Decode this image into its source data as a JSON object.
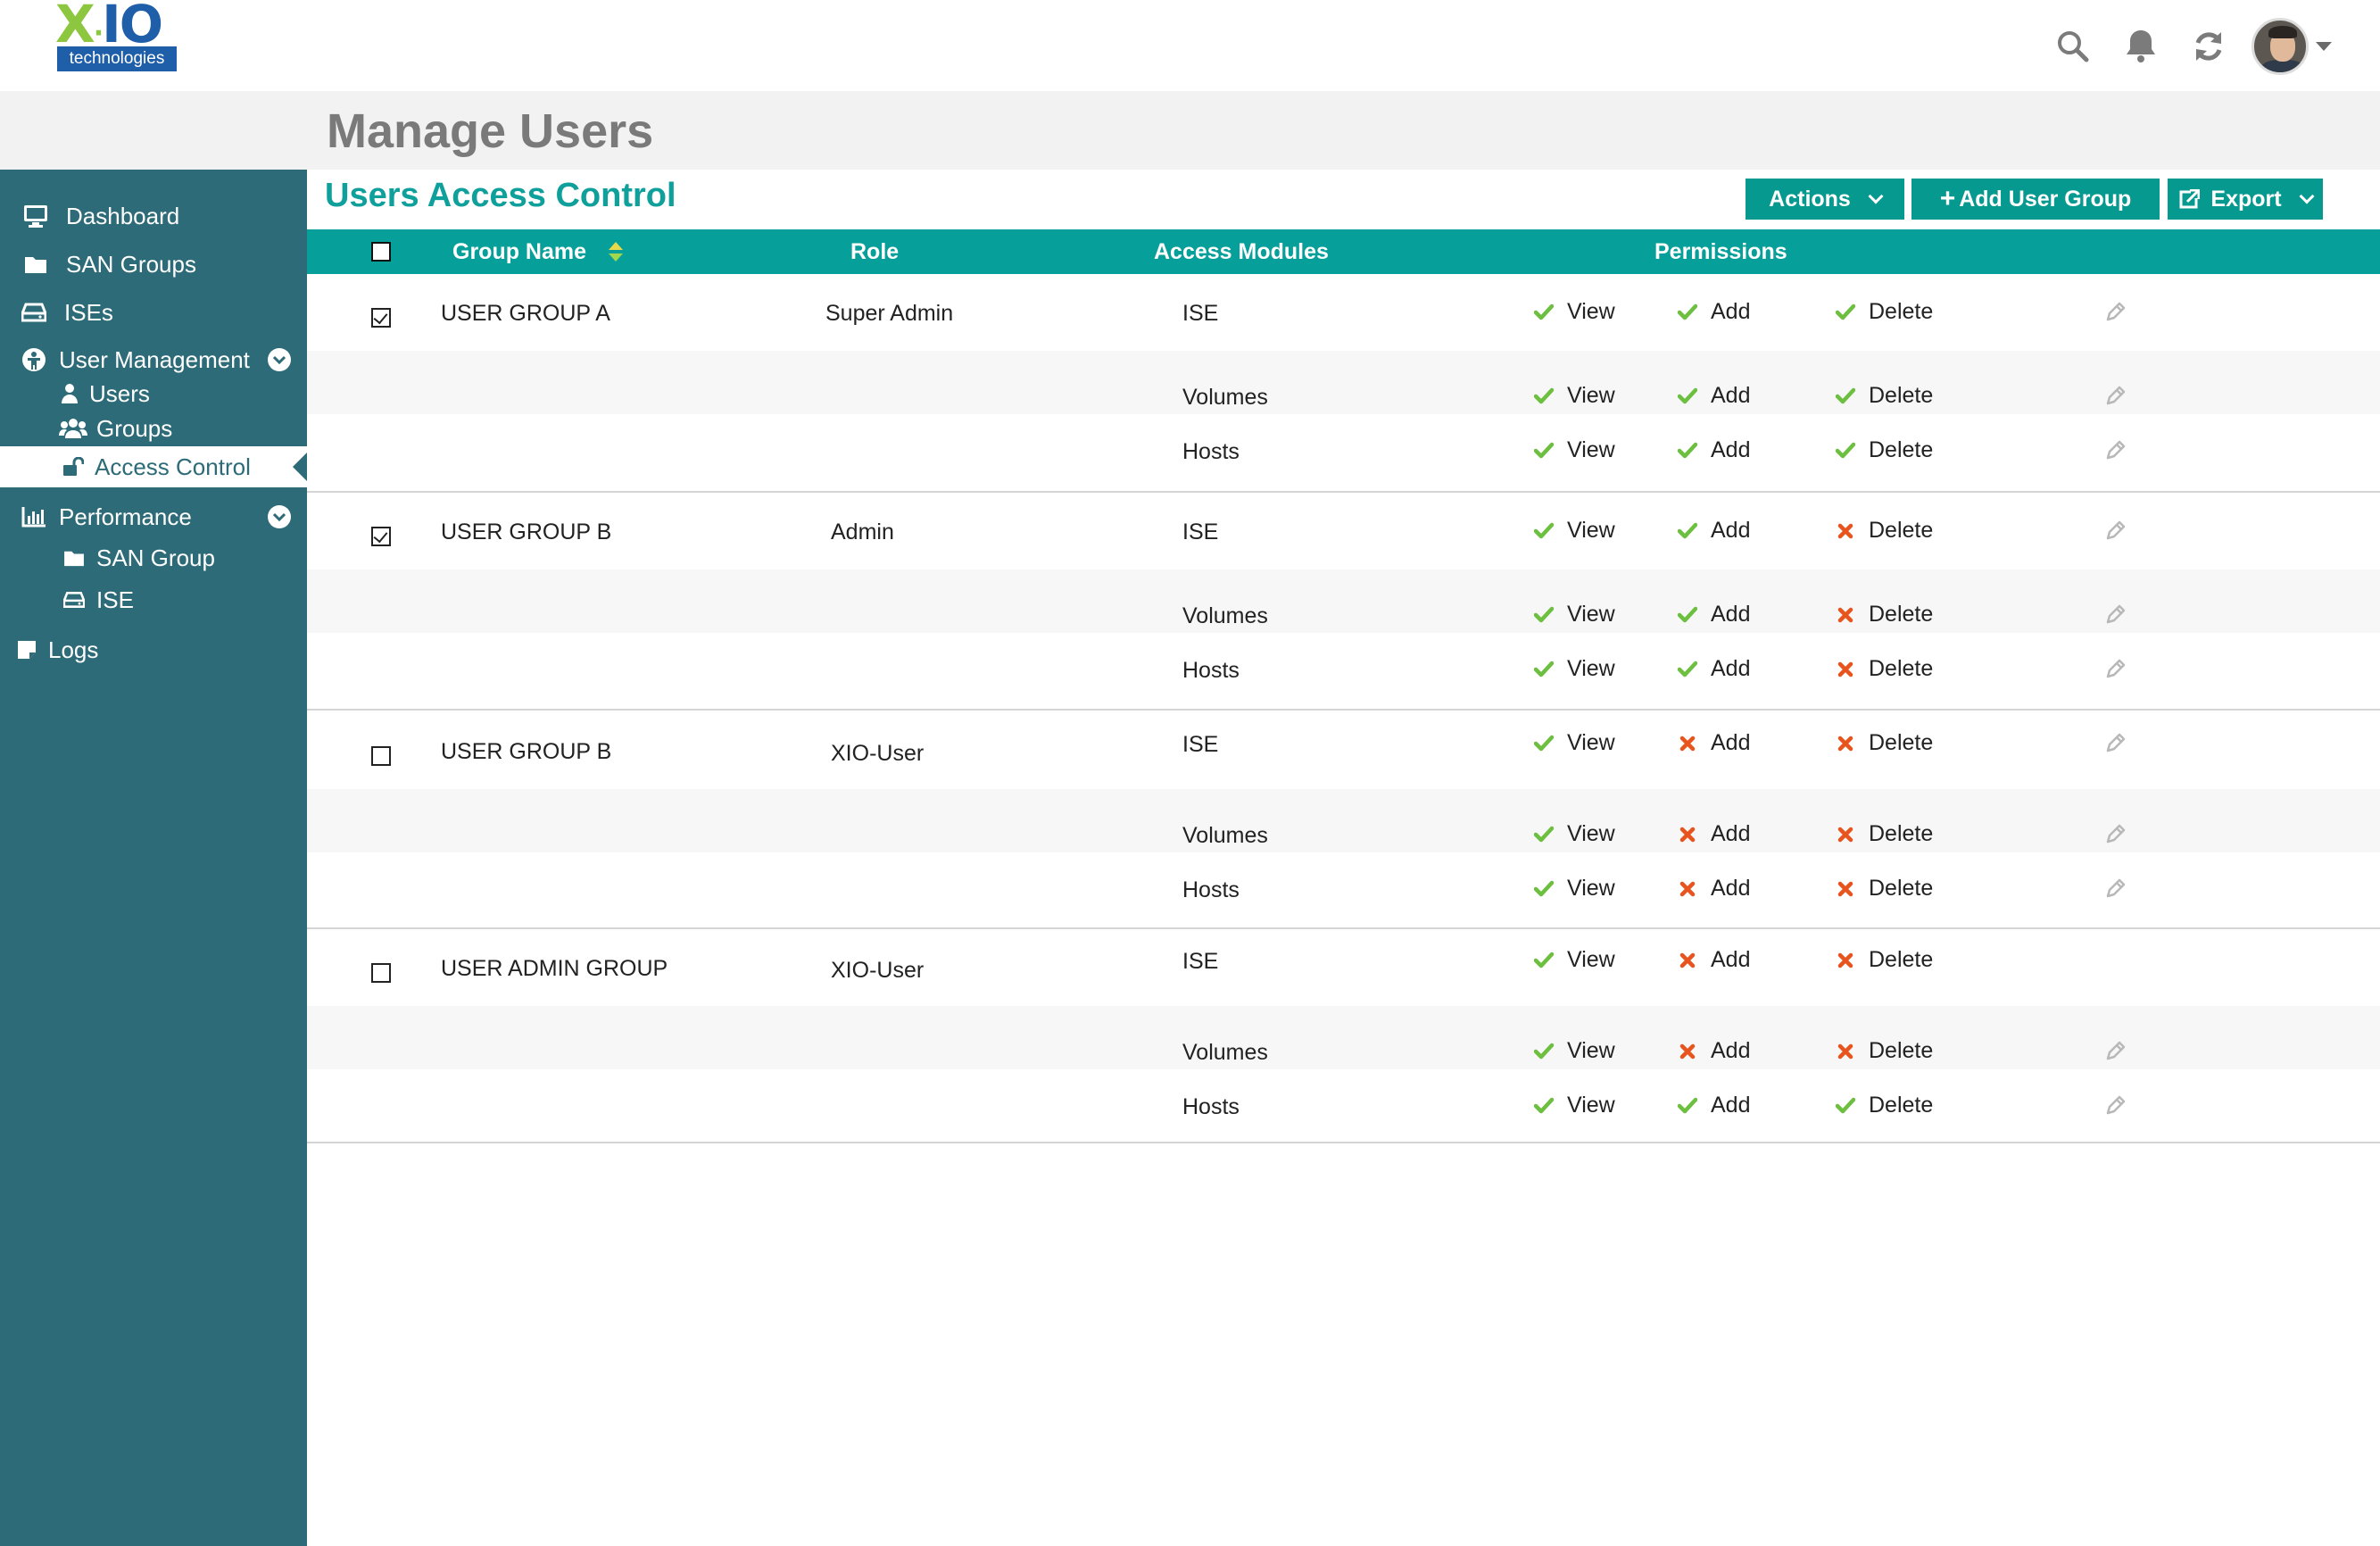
{
  "brand": {
    "logo_x": "X",
    "logo_io": "IO",
    "logo_sub": "technologies",
    "logo_tm": "TM"
  },
  "header": {
    "page_title": "Manage Users"
  },
  "sidebar": {
    "items": [
      {
        "label": "Dashboard",
        "icon": "monitor-icon"
      },
      {
        "label": "SAN Groups",
        "icon": "folder-icon"
      },
      {
        "label": "ISEs",
        "icon": "drive-icon"
      },
      {
        "label": "User Management",
        "icon": "user-management-icon",
        "expanded": true
      },
      {
        "label": "Users",
        "icon": "user-icon"
      },
      {
        "label": "Groups",
        "icon": "users-icon"
      },
      {
        "label": "Access Control",
        "icon": "unlock-icon",
        "active": true
      },
      {
        "label": "Performance",
        "icon": "bar-chart-icon",
        "expanded": true
      },
      {
        "label": "SAN Group",
        "icon": "folder-icon"
      },
      {
        "label": "ISE",
        "icon": "drive-icon"
      },
      {
        "label": "Logs",
        "icon": "note-icon"
      }
    ]
  },
  "section": {
    "title": "Users Access Control"
  },
  "toolbar": {
    "actions_label": "Actions",
    "add_group_label": "Add User Group",
    "export_label": "Export"
  },
  "table": {
    "headers": {
      "group_name": "Group Name",
      "role": "Role",
      "access_modules": "Access Modules",
      "permissions": "Permissions"
    },
    "perm_labels": {
      "view": "View",
      "add": "Add",
      "delete": "Delete"
    },
    "groups": [
      {
        "name": "USER GROUP A",
        "role": "Super Admin",
        "checked": true,
        "modules": [
          {
            "name": "ISE",
            "view": true,
            "add": true,
            "delete": true,
            "editable": true
          },
          {
            "name": "Volumes",
            "view": true,
            "add": true,
            "delete": true,
            "editable": true
          },
          {
            "name": "Hosts",
            "view": true,
            "add": true,
            "delete": true,
            "editable": true
          }
        ]
      },
      {
        "name": "USER GROUP B",
        "role": "Admin",
        "checked": true,
        "modules": [
          {
            "name": "ISE",
            "view": true,
            "add": true,
            "delete": false,
            "editable": true
          },
          {
            "name": "Volumes",
            "view": true,
            "add": true,
            "delete": false,
            "editable": true
          },
          {
            "name": "Hosts",
            "view": true,
            "add": true,
            "delete": false,
            "editable": true
          }
        ]
      },
      {
        "name": "USER GROUP B",
        "role": "XIO-User",
        "checked": false,
        "modules": [
          {
            "name": "ISE",
            "view": true,
            "add": false,
            "delete": false,
            "editable": true
          },
          {
            "name": "Volumes",
            "view": true,
            "add": false,
            "delete": false,
            "editable": true
          },
          {
            "name": "Hosts",
            "view": true,
            "add": false,
            "delete": false,
            "editable": true
          }
        ]
      },
      {
        "name": "USER ADMIN GROUP",
        "role": "XIO-User",
        "checked": false,
        "modules": [
          {
            "name": "ISE",
            "view": true,
            "add": false,
            "delete": false,
            "editable": false
          },
          {
            "name": "Volumes",
            "view": true,
            "add": false,
            "delete": false,
            "editable": true
          },
          {
            "name": "Hosts",
            "view": true,
            "add": true,
            "delete": true,
            "editable": true
          }
        ]
      }
    ]
  },
  "colors": {
    "sidebar": "#2c6b77",
    "accent": "#0fa09c",
    "header_bg": "#079f99",
    "allow": "#6cbf3f",
    "deny": "#e8541e"
  }
}
